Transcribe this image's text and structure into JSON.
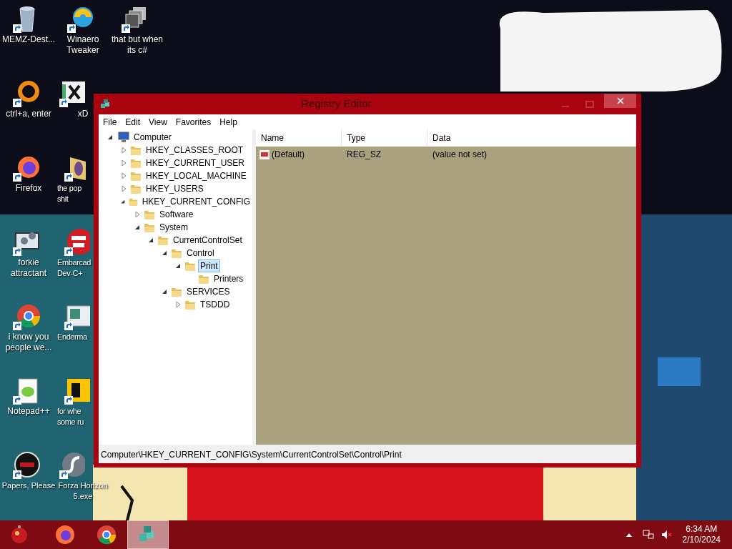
{
  "desktop_icons": [
    {
      "lines": [
        "MEMZ-Dest..."
      ]
    },
    {
      "lines": [
        "ctrl+a, enter"
      ]
    },
    {
      "lines": [
        "Firefox"
      ]
    },
    {
      "lines": [
        "forkie",
        "attractant"
      ]
    },
    {
      "lines": [
        "i know you",
        "people we..."
      ]
    },
    {
      "lines": [
        "Notepad++"
      ]
    },
    {
      "lines": [
        "Papers, Please"
      ]
    },
    {
      "lines": [
        "Winaero",
        "Tweaker"
      ]
    },
    {
      "lines": [
        "xD"
      ]
    },
    {
      "lines": [
        "the pop",
        "shit"
      ]
    },
    {
      "lines": [
        "Embarcad",
        "Dev-C+"
      ]
    },
    {
      "lines": [
        "Enderma"
      ]
    },
    {
      "lines": [
        "for whe",
        "some ru"
      ]
    },
    {
      "lines": [
        "Forza Horizon",
        "5.exe"
      ]
    },
    {
      "lines": [
        "that but when",
        "its c#"
      ]
    }
  ],
  "window": {
    "title": "Registry Editor",
    "menu": [
      "File",
      "Edit",
      "View",
      "Favorites",
      "Help"
    ],
    "tree": [
      {
        "label": "Computer",
        "kind": "computer",
        "expandable": true,
        "expanded": true,
        "selected": false,
        "children": [
          {
            "label": "HKEY_CLASSES_ROOT",
            "kind": "key",
            "expandable": true,
            "expanded": false,
            "selected": false
          },
          {
            "label": "HKEY_CURRENT_USER",
            "kind": "key",
            "expandable": true,
            "expanded": false,
            "selected": false
          },
          {
            "label": "HKEY_LOCAL_MACHINE",
            "kind": "key",
            "expandable": true,
            "expanded": false,
            "selected": false
          },
          {
            "label": "HKEY_USERS",
            "kind": "key",
            "expandable": true,
            "expanded": false,
            "selected": false
          },
          {
            "label": "HKEY_CURRENT_CONFIG",
            "kind": "key",
            "expandable": true,
            "expanded": true,
            "selected": false,
            "children": [
              {
                "label": "Software",
                "kind": "key",
                "expandable": true,
                "expanded": false,
                "selected": false
              },
              {
                "label": "System",
                "kind": "key",
                "expandable": true,
                "expanded": true,
                "selected": false,
                "children": [
                  {
                    "label": "CurrentControlSet",
                    "kind": "key",
                    "expandable": true,
                    "expanded": true,
                    "selected": false,
                    "children": [
                      {
                        "label": "Control",
                        "kind": "key",
                        "expandable": true,
                        "expanded": true,
                        "selected": false,
                        "children": [
                          {
                            "label": "Print",
                            "kind": "key",
                            "expandable": true,
                            "expanded": true,
                            "selected": true,
                            "children": [
                              {
                                "label": "Printers",
                                "kind": "key",
                                "expandable": false,
                                "expanded": false,
                                "selected": false
                              }
                            ]
                          }
                        ]
                      },
                      {
                        "label": "SERVICES",
                        "kind": "key",
                        "expandable": true,
                        "expanded": true,
                        "selected": false,
                        "children": [
                          {
                            "label": "TSDDD",
                            "kind": "key",
                            "expandable": true,
                            "expanded": false,
                            "selected": false
                          }
                        ]
                      }
                    ]
                  }
                ]
              }
            ]
          }
        ]
      }
    ],
    "columns": [
      "Name",
      "Type",
      "Data"
    ],
    "values": [
      {
        "name": "(Default)",
        "type": "REG_SZ",
        "data": "(value not set)"
      }
    ],
    "status_bar": "Computer\\HKEY_CURRENT_CONFIG\\System\\CurrentControlSet\\Control\\Print"
  },
  "taskbar": {
    "apps": [
      {
        "selected": false
      },
      {
        "selected": false
      },
      {
        "selected": true
      }
    ],
    "time": "6:34 AM",
    "date": "2/10/2024"
  }
}
